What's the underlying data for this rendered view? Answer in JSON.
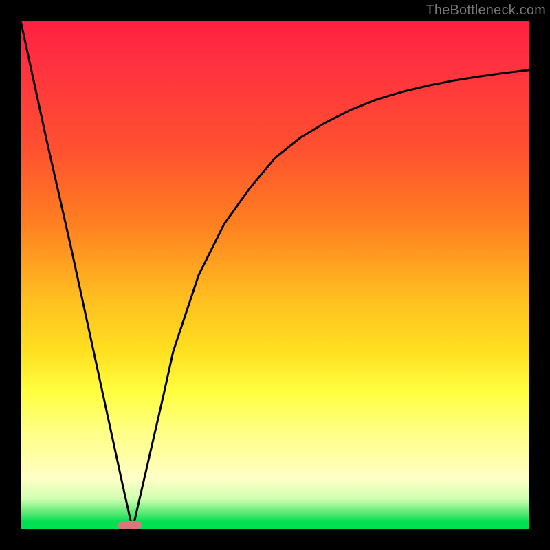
{
  "watermark": "TheBottleneck.com",
  "chart_data": {
    "type": "line",
    "title": "",
    "xlabel": "",
    "ylabel": "",
    "xlim": [
      0,
      100
    ],
    "ylim": [
      0,
      100
    ],
    "grid": false,
    "series": [
      {
        "name": "curve",
        "x": [
          0,
          5,
          10,
          15,
          20,
          22,
          25,
          28,
          30,
          35,
          40,
          45,
          50,
          55,
          60,
          65,
          70,
          75,
          80,
          85,
          90,
          95,
          100
        ],
        "y": [
          100,
          77,
          55,
          32,
          9,
          0,
          13,
          26,
          35,
          50,
          60,
          67,
          73,
          77,
          80,
          82.5,
          84.5,
          86,
          87.2,
          88.2,
          89,
          89.7,
          90.3
        ]
      }
    ],
    "marker": {
      "x_center": 21.5,
      "width_pct": 4.5,
      "color": "#d47a7a"
    },
    "gradient_stops": [
      {
        "pct": 0,
        "color": "#ff2040"
      },
      {
        "pct": 25,
        "color": "#ff5030"
      },
      {
        "pct": 55,
        "color": "#ffc020"
      },
      {
        "pct": 73,
        "color": "#ffff40"
      },
      {
        "pct": 94,
        "color": "#d0ffb0"
      },
      {
        "pct": 100,
        "color": "#00e050"
      }
    ]
  }
}
